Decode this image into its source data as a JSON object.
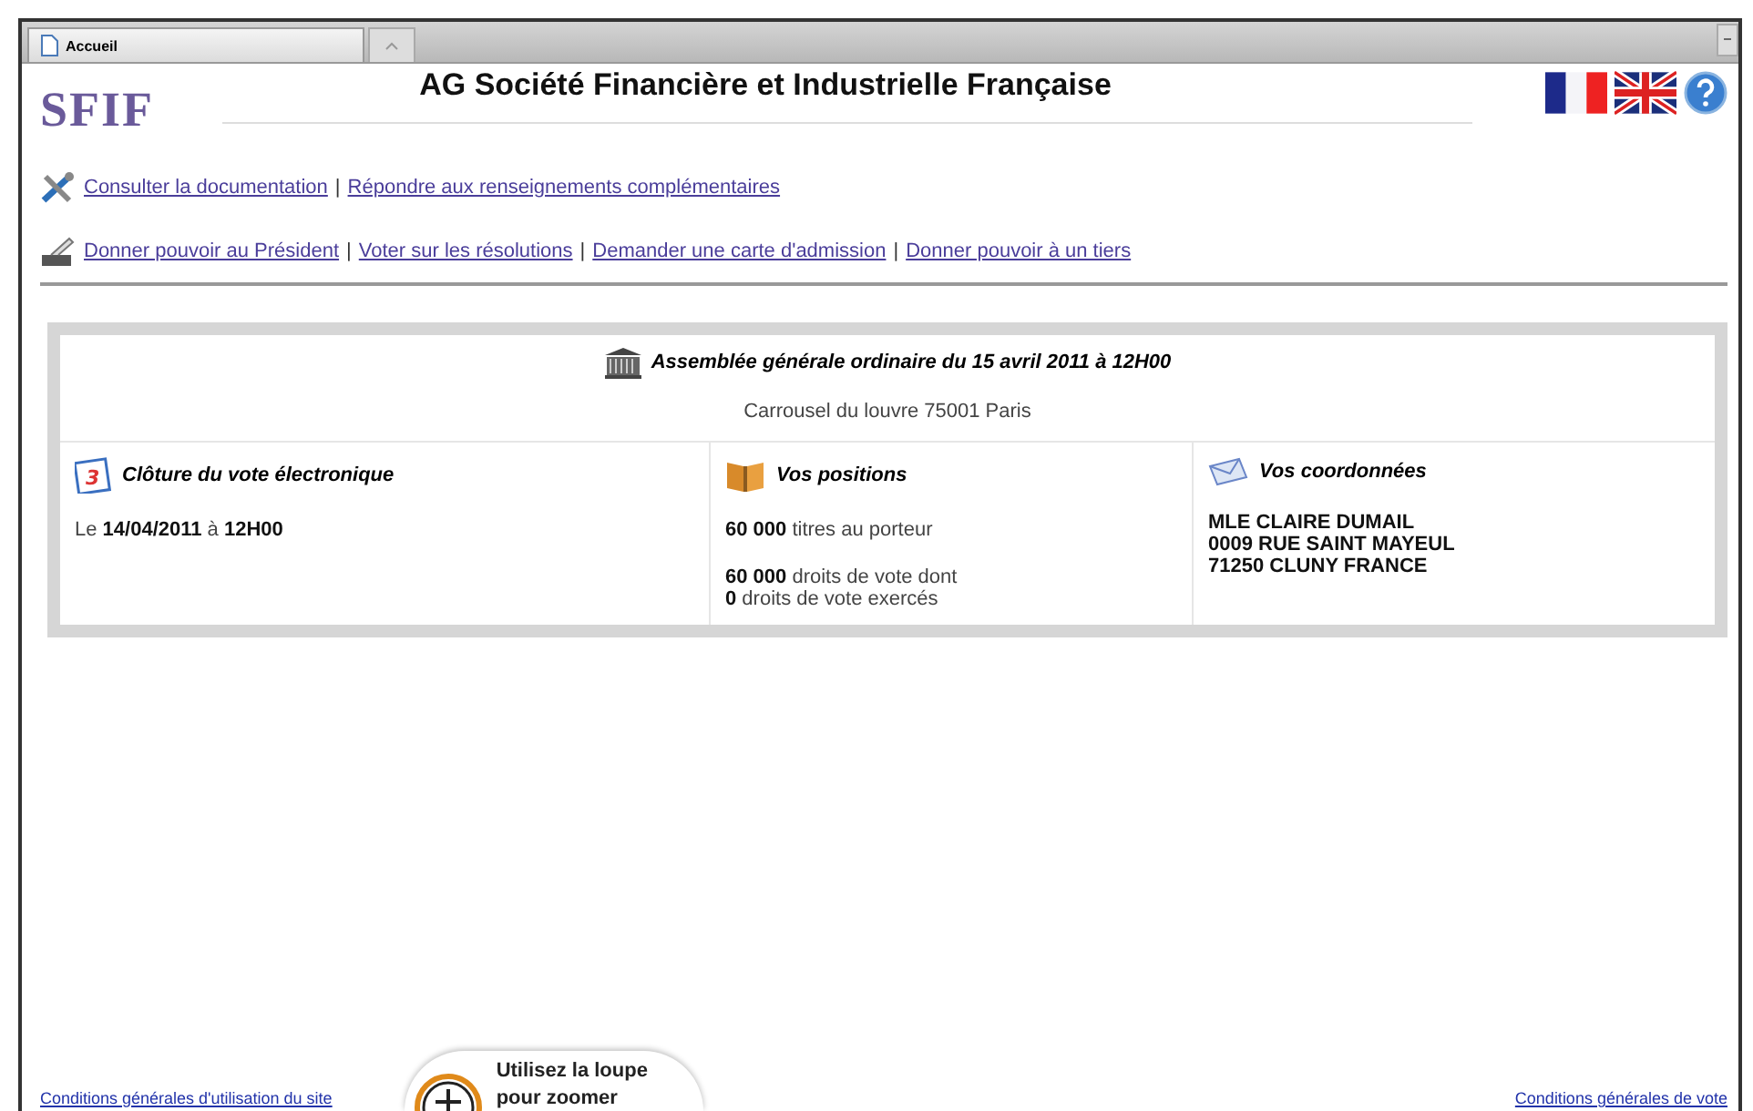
{
  "browser": {
    "tab_title": "Accueil"
  },
  "header": {
    "logo": "SFIF",
    "title": "AG Société Financière et Industrielle Française"
  },
  "link_rows": [
    {
      "kind": "tools",
      "separator": "|",
      "links": [
        "Consulter la documentation",
        "Répondre aux renseignements complémentaires"
      ]
    },
    {
      "kind": "vote",
      "separator": "|",
      "links": [
        "Donner pouvoir au Président",
        "Voter sur les résolutions",
        "Demander une carte d'admission",
        "Donner pouvoir à un tiers"
      ]
    }
  ],
  "meeting": {
    "title": "Assemblée générale ordinaire du 15 avril 2011 à 12H00",
    "location": "Carrousel du louvre 75001 Paris"
  },
  "sections": [
    {
      "kind": "calendar",
      "icon_text": "3",
      "title": "Clôture du vote électronique",
      "paragraphs": [
        [
          "Le **14/04/2011** à **12H00**"
        ]
      ]
    },
    {
      "kind": "book",
      "title": "Vos positions",
      "paragraphs": [
        [
          "**60 000** titres au porteur"
        ],
        [
          "**60 000** droits de vote dont",
          "**0** droits de vote exercés"
        ]
      ]
    },
    {
      "kind": "mail",
      "title": "Vos coordonnées",
      "paragraphs": [
        [
          "**MLE CLAIRE DUMAIL**",
          "**0009 RUE SAINT MAYEUL**",
          "**71250 CLUNY FRANCE**"
        ]
      ]
    }
  ],
  "footer": {
    "left_link": "Conditions générales d'utilisation du site",
    "right_link": "Conditions générales de vote"
  },
  "callout": {
    "text": "Utilisez la loupe pour zoomer"
  }
}
